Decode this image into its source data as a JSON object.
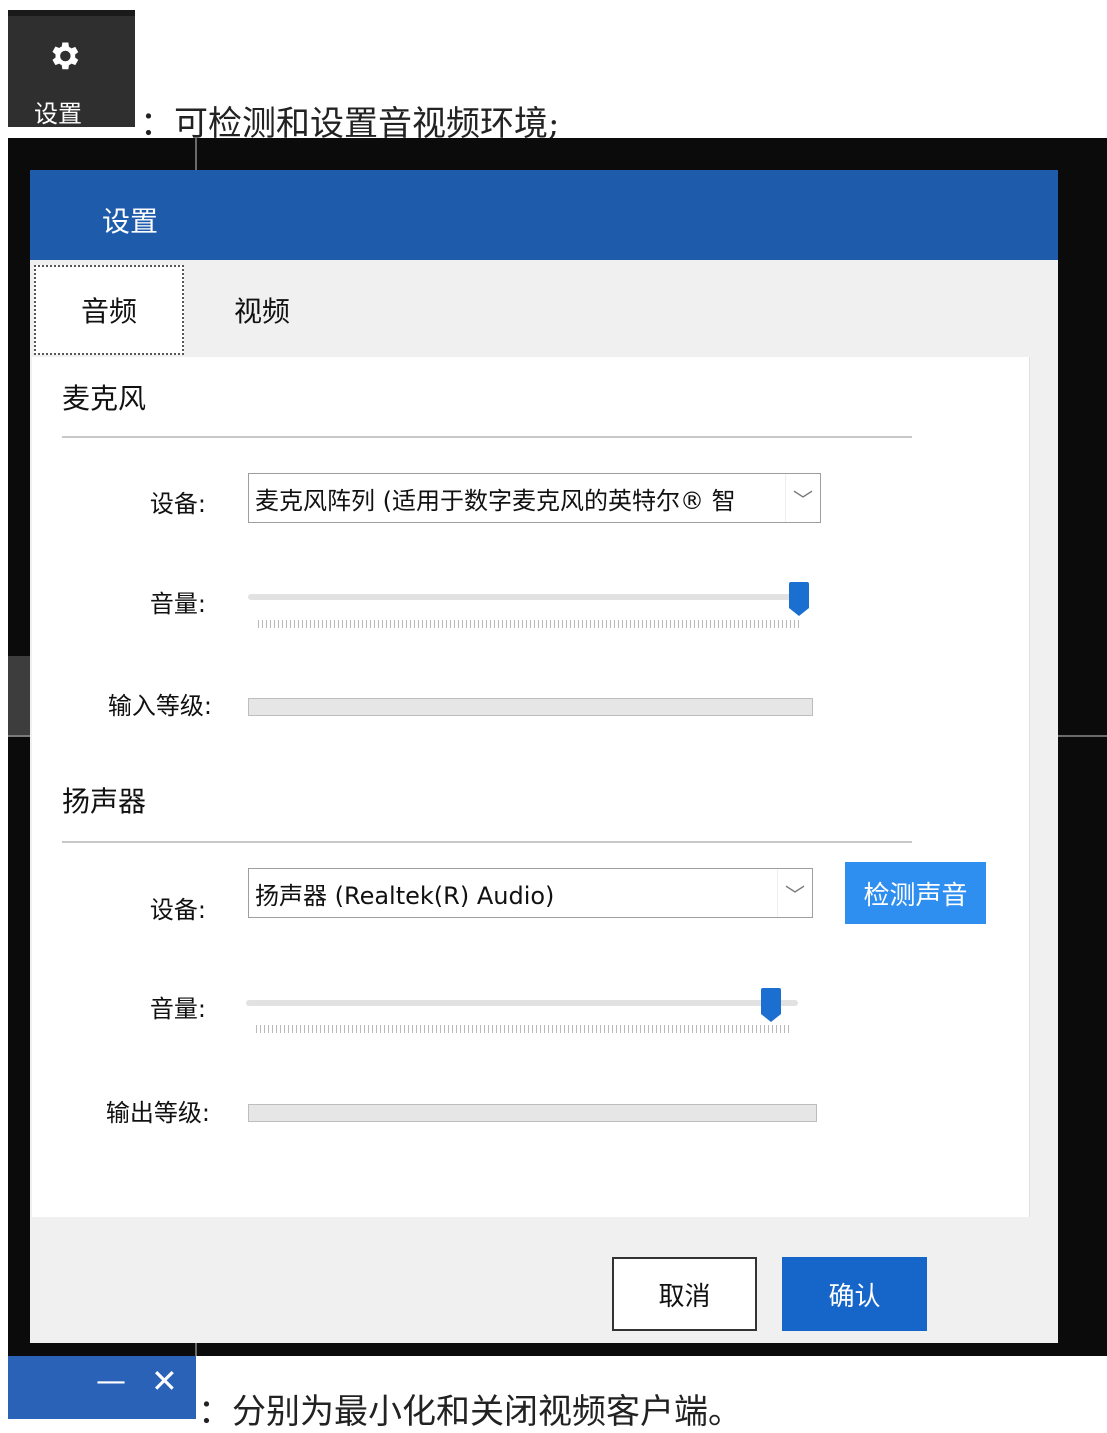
{
  "intro": {
    "settings_tile_label": "设置",
    "caption_settings": "：可检测和设置音视频环境;",
    "caption_controls": "：分别为最小化和关闭视频客户端。"
  },
  "dialog": {
    "title": "设置",
    "tabs": [
      "音频",
      "视频"
    ],
    "active_tab": "音频",
    "microphone": {
      "section_title": "麦克风",
      "device_label": "设备:",
      "device_value": "麦克风阵列 (适用于数字麦克风的英特尔® 智",
      "volume_label": "音量:",
      "volume_level": 1.0,
      "input_level_label": "输入等级:",
      "input_level": 0
    },
    "speaker": {
      "section_title": "扬声器",
      "device_label": "设备:",
      "device_value": "扬声器 (Realtek(R) Audio)",
      "test_button": "检测声音",
      "volume_label": "音量:",
      "volume_level": 1.0,
      "output_level_label": "输出等级:",
      "output_level": 0
    },
    "cancel_button": "取消",
    "ok_button": "确认"
  },
  "window_controls": {
    "minimize_glyph": "—",
    "close_glyph": "✕"
  },
  "colors": {
    "header_blue": "#1f5bab",
    "accent_blue": "#2f8ff0",
    "ok_blue": "#1665c9",
    "thumb_blue": "#1a6fd1"
  }
}
